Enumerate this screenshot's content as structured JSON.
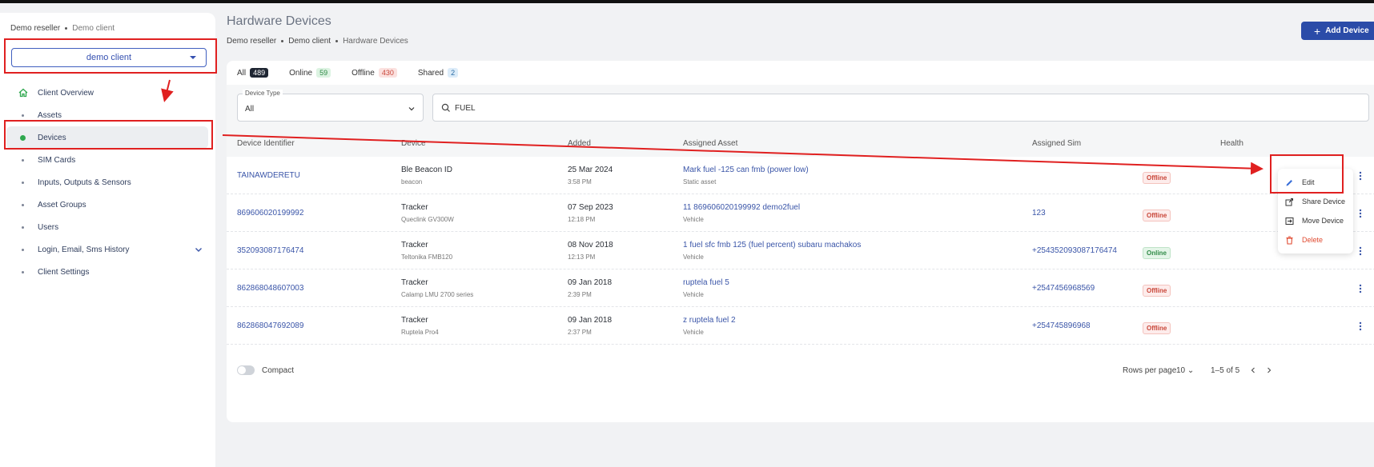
{
  "sidebar": {
    "breadcrumb": [
      "Demo reseller",
      "Demo client"
    ],
    "client_select": "demo client",
    "items": [
      {
        "label": "Client Overview"
      },
      {
        "label": "Assets"
      },
      {
        "label": "Devices"
      },
      {
        "label": "SIM Cards"
      },
      {
        "label": "Inputs, Outputs & Sensors"
      },
      {
        "label": "Asset Groups"
      },
      {
        "label": "Users"
      },
      {
        "label": "Login, Email, Sms History"
      },
      {
        "label": "Client Settings"
      }
    ]
  },
  "header": {
    "title": "Hardware Devices",
    "breadcrumb": [
      "Demo reseller",
      "Demo client",
      "Hardware Devices"
    ],
    "add_label": "Add Device"
  },
  "tabs": [
    {
      "label": "All",
      "count": "489"
    },
    {
      "label": "Online",
      "count": "59"
    },
    {
      "label": "Offline",
      "count": "430"
    },
    {
      "label": "Shared",
      "count": "2"
    }
  ],
  "filters": {
    "device_type_label": "Device Type",
    "device_type_value": "All",
    "search_value": "FUEL"
  },
  "columns": [
    "Device Identifier",
    "Device",
    "Added",
    "Assigned Asset",
    "Assigned Sim",
    "Health"
  ],
  "rows": [
    {
      "id": "TAINAWDERETU",
      "device": "Ble Beacon ID",
      "device_sub": "beacon",
      "date": "25 Mar 2024",
      "time": "3:58 PM",
      "asset": "Mark fuel -125 can fmb (power low)",
      "asset_sub": "Static asset",
      "sim": "",
      "health": "Offline"
    },
    {
      "id": "869606020199992",
      "device": "Tracker",
      "device_sub": "Queclink GV300W",
      "date": "07 Sep 2023",
      "time": "12:18 PM",
      "asset": "11 869606020199992 demo2fuel",
      "asset_sub": "Vehicle",
      "sim": "123",
      "health": "Offline"
    },
    {
      "id": "352093087176474",
      "device": "Tracker",
      "device_sub": "Teltonika FMB120",
      "date": "08 Nov 2018",
      "time": "12:13 PM",
      "asset": "1 fuel sfc fmb 125 (fuel percent) subaru machakos",
      "asset_sub": "Vehicle",
      "sim": "+254352093087176474",
      "health": "Online"
    },
    {
      "id": "862868048607003",
      "device": "Tracker",
      "device_sub": "Calamp LMU 2700 series",
      "date": "09 Jan 2018",
      "time": "2:39 PM",
      "asset": "ruptela fuel 5",
      "asset_sub": "Vehicle",
      "sim": "+2547456968569",
      "health": "Offline"
    },
    {
      "id": "862868047692089",
      "device": "Tracker",
      "device_sub": "Ruptela Pro4",
      "date": "09 Jan 2018",
      "time": "2:37 PM",
      "asset": "z ruptela fuel 2",
      "asset_sub": "Vehicle",
      "sim": "+254745896968",
      "health": "Offline"
    }
  ],
  "footer": {
    "compact_label": "Compact",
    "rows_per_page_label": "Rows per page",
    "rows_per_page_value": "10",
    "range": "1–5 of 5"
  },
  "menu": {
    "edit": "Edit",
    "share": "Share Device",
    "move": "Move Device",
    "delete": "Delete"
  },
  "colors": {
    "primary": "#2b4ca8",
    "annotation": "#e02020",
    "online": "#2f8a46",
    "offline": "#c9473a"
  }
}
